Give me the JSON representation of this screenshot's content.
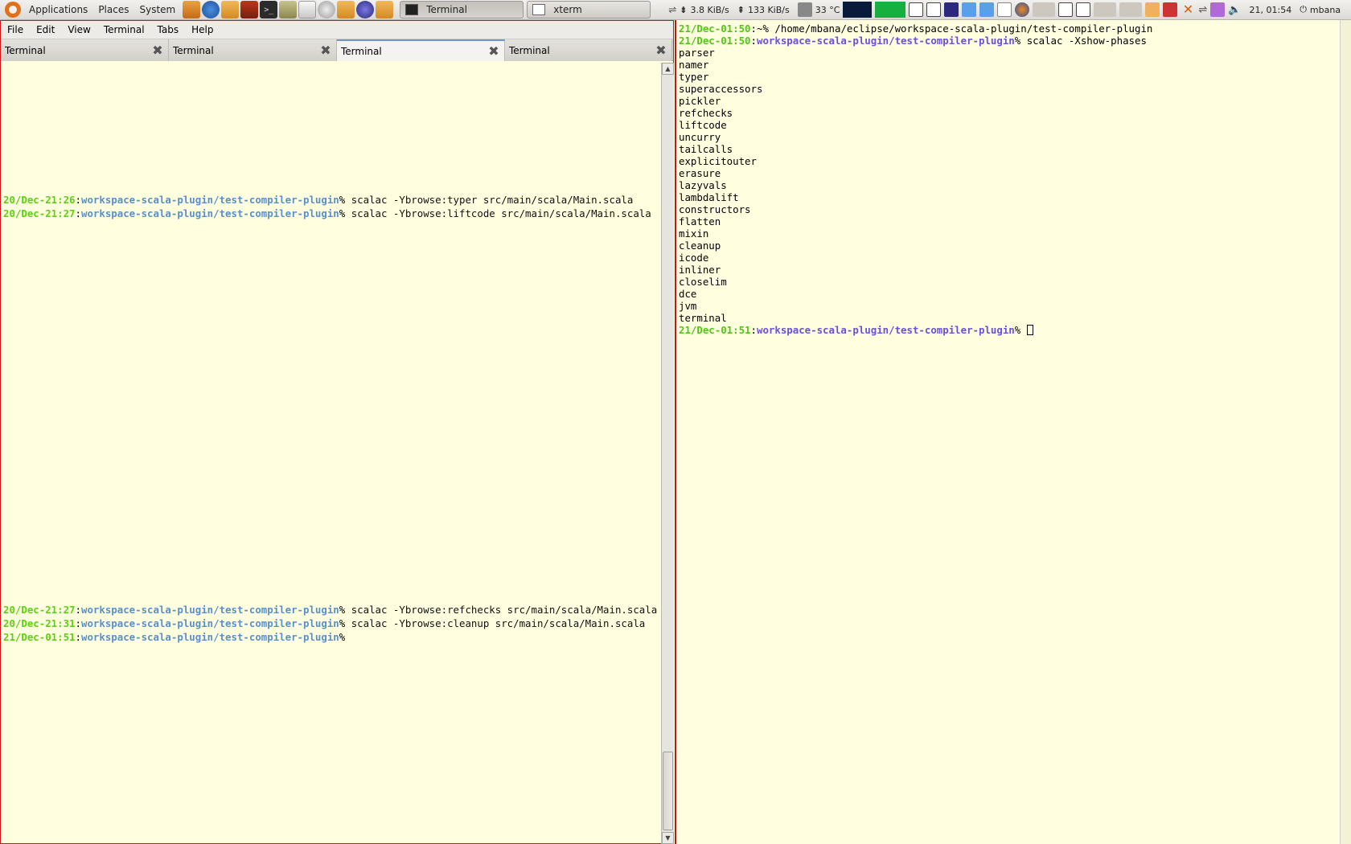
{
  "panel": {
    "menus": [
      "Applications",
      "Places",
      "System"
    ],
    "launchers": [
      "home-folder-icon",
      "thunderbird-icon",
      "folder-icon",
      "presentation-icon",
      "terminal-icon",
      "archive-icon",
      "text-editor-icon",
      "disk-icon",
      "folder-icon",
      "eclipse-icon",
      "folder-icon"
    ],
    "tasks": [
      {
        "label": "Terminal",
        "icon": "terminal-icon",
        "active": true
      },
      {
        "label": "xterm",
        "icon": "xterm-icon",
        "active": false
      }
    ],
    "net_down": "3.8 KiB/s",
    "net_up": "133 KiB/s",
    "temperature": "33 °C",
    "clock": "21, 01:54",
    "user": "mbana"
  },
  "gnome_terminal": {
    "menubar": [
      "File",
      "Edit",
      "View",
      "Terminal",
      "Tabs",
      "Help"
    ],
    "tabs": [
      {
        "label": "Terminal",
        "active": false
      },
      {
        "label": "Terminal",
        "active": false
      },
      {
        "label": "Terminal",
        "active": true
      },
      {
        "label": "Terminal",
        "active": false
      }
    ],
    "lines": [
      {
        "date": "20/Dec-21:26",
        "path": "workspace-scala-plugin/test-compiler-plugin",
        "cmd": " scalac -Ybrowse:typer src/main/scala/Main.scala"
      },
      {
        "date": "20/Dec-21:27",
        "path": "workspace-scala-plugin/test-compiler-plugin",
        "cmd": " scalac -Ybrowse:liftcode src/main/scala/Main.scala"
      },
      {
        "date": "20/Dec-21:27",
        "path": "workspace-scala-plugin/test-compiler-plugin",
        "cmd": " scalac -Ybrowse:refchecks src/main/scala/Main.scala"
      },
      {
        "date": "20/Dec-21:31",
        "path": "workspace-scala-plugin/test-compiler-plugin",
        "cmd": " scalac -Ybrowse:cleanup src/main/scala/Main.scala"
      },
      {
        "date": "21/Dec-01:51",
        "path": "workspace-scala-plugin/test-compiler-plugin",
        "cmd": ""
      }
    ]
  },
  "xterm": {
    "line1": {
      "date": "21/Dec-01:50",
      "path": "~",
      "cmd": " /home/mbana/eclipse/workspace-scala-plugin/test-compiler-plugin"
    },
    "line2": {
      "date": "21/Dec-01:50",
      "path": "workspace-scala-plugin/test-compiler-plugin",
      "cmd": " scalac -Xshow-phases"
    },
    "phases": [
      "parser",
      "namer",
      "typer",
      "superaccessors",
      "pickler",
      "refchecks",
      "liftcode",
      "uncurry",
      "tailcalls",
      "explicitouter",
      "erasure",
      "lazyvals",
      "lambdalift",
      "constructors",
      "flatten",
      "mixin",
      "cleanup",
      "icode",
      "inliner",
      "closelim",
      "dce",
      "jvm",
      "terminal"
    ],
    "last_prompt": {
      "date": "21/Dec-01:51",
      "path": "workspace-scala-plugin/test-compiler-plugin"
    }
  }
}
